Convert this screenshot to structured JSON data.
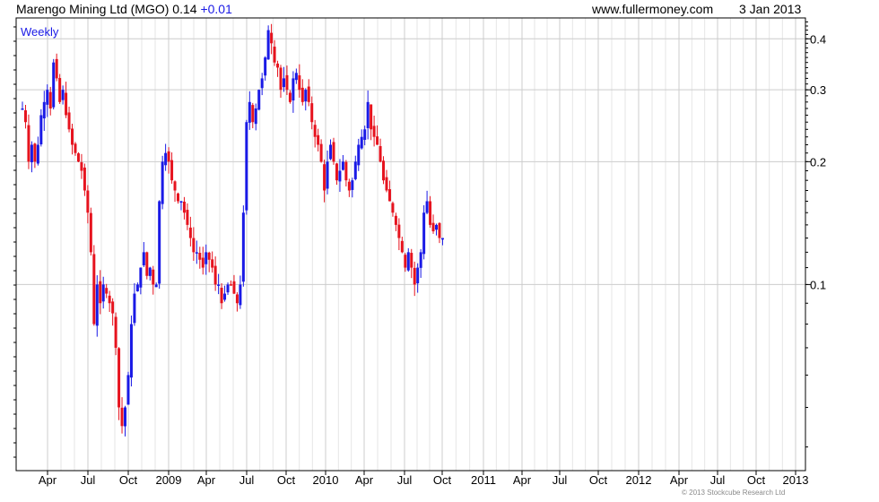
{
  "header": {
    "title": "Marengo Mining Ltd (MGO)",
    "price": "0.14",
    "change": "+0.01",
    "website": "www.fullermoney.com",
    "date": "3 Jan 2013"
  },
  "chart_data": {
    "type": "candlestick",
    "period_label": "Weekly",
    "copyright": "© 2013 Stockcube Research Ltd",
    "x_axis": {
      "tick_labels": [
        "Apr",
        "Jul",
        "Oct",
        "2009",
        "Apr",
        "Jul",
        "Oct",
        "2010",
        "Apr",
        "Jul",
        "Oct",
        "2011",
        "Apr",
        "Jul",
        "Oct",
        "2012",
        "Apr",
        "Jul",
        "Oct",
        "2013"
      ],
      "range_weeks": [
        0,
        253
      ]
    },
    "y_axis": {
      "position": "right",
      "scale": "log",
      "range": [
        0.035,
        0.45
      ],
      "tick_labels": [
        "0.1",
        "0.2",
        "0.3",
        "0.4"
      ],
      "tick_values": [
        0.1,
        0.2,
        0.3,
        0.4
      ]
    },
    "grid": true,
    "colors": {
      "up": "#1a1ae6",
      "down": "#e6131e",
      "grid": "#cccccc",
      "frame": "#000000"
    },
    "series_close": [
      0.27,
      0.25,
      0.2,
      0.22,
      0.2,
      0.22,
      0.26,
      0.28,
      0.3,
      0.27,
      0.35,
      0.32,
      0.28,
      0.3,
      0.26,
      0.24,
      0.22,
      0.21,
      0.2,
      0.19,
      0.17,
      0.15,
      0.12,
      0.08,
      0.1,
      0.09,
      0.1,
      0.095,
      0.09,
      0.085,
      0.07,
      0.05,
      0.045,
      0.05,
      0.06,
      0.08,
      0.095,
      0.1,
      0.11,
      0.12,
      0.105,
      0.11,
      0.1,
      0.1,
      0.16,
      0.2,
      0.21,
      0.2,
      0.18,
      0.17,
      0.16,
      0.16,
      0.15,
      0.14,
      0.13,
      0.12,
      0.12,
      0.115,
      0.11,
      0.12,
      0.115,
      0.11,
      0.1,
      0.1,
      0.09,
      0.095,
      0.1,
      0.1,
      0.095,
      0.09,
      0.1,
      0.15,
      0.25,
      0.28,
      0.25,
      0.27,
      0.3,
      0.32,
      0.36,
      0.42,
      0.39,
      0.35,
      0.34,
      0.3,
      0.32,
      0.3,
      0.28,
      0.32,
      0.33,
      0.3,
      0.28,
      0.3,
      0.28,
      0.25,
      0.23,
      0.22,
      0.2,
      0.17,
      0.2,
      0.22,
      0.2,
      0.18,
      0.19,
      0.2,
      0.18,
      0.17,
      0.18,
      0.2,
      0.22,
      0.23,
      0.24,
      0.28,
      0.24,
      0.23,
      0.22,
      0.2,
      0.18,
      0.17,
      0.16,
      0.15,
      0.14,
      0.13,
      0.12,
      0.11,
      0.12,
      0.11,
      0.1,
      0.11,
      0.12,
      0.15,
      0.16,
      0.14,
      0.135,
      0.14,
      0.13,
      0.13
    ]
  }
}
